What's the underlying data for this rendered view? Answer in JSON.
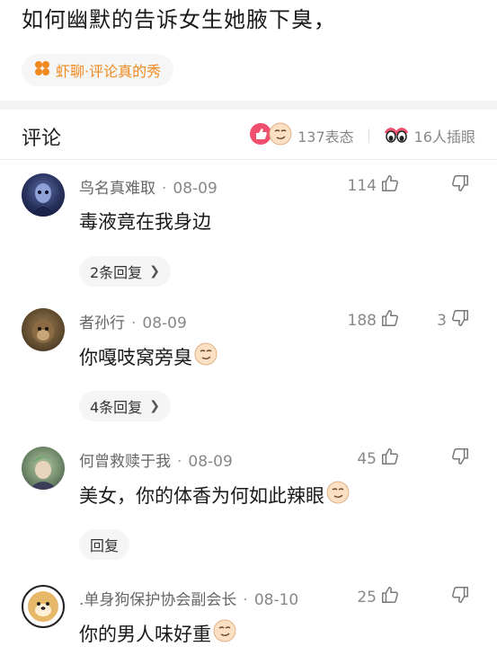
{
  "post": {
    "title": "如何幽默的告诉女生她腋下臭，",
    "topic_chip": "虾聊·评论真的秀"
  },
  "comments_header": {
    "title": "评论",
    "reactions_label": "137表态",
    "viewers_label": "16人插眼"
  },
  "colors": {
    "accent_orange": "#f08a1f",
    "like_red": "#f0506e",
    "text_gray": "#888888"
  },
  "icons": {
    "topic": "orange-clover-icon",
    "like": "thumbs-up-icon",
    "dislike": "thumbs-down-icon",
    "emoji": "smirk-face-emoji",
    "eyes": "peeking-eyes-icon"
  },
  "comments": [
    {
      "author": "鸟名真难取",
      "date": "08-09",
      "text": "毒液竟在我身边",
      "likes": "114",
      "dislikes": "",
      "reply_label": "2条回复",
      "has_emoji": false
    },
    {
      "author": "者孙行",
      "date": "08-09",
      "text": "你嘎吱窝旁臭",
      "likes": "188",
      "dislikes": "3",
      "reply_label": "4条回复",
      "has_emoji": true
    },
    {
      "author": "何曾救赎于我",
      "date": "08-09",
      "text": "美女，你的体香为何如此辣眼",
      "likes": "45",
      "dislikes": "",
      "reply_label": "回复",
      "has_emoji": true
    },
    {
      "author": ".单身狗保护协会副会长",
      "date": "08-10",
      "text": "你的男人味好重",
      "likes": "25",
      "dislikes": "",
      "reply_label": "",
      "has_emoji": true
    }
  ]
}
